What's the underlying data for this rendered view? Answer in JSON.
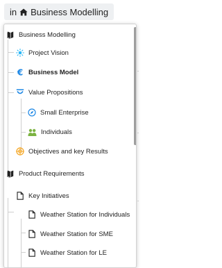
{
  "breadcrumb": {
    "prefix": "in",
    "title": "Business Modelling"
  },
  "tree": {
    "business_modelling": "Business Modelling",
    "project_vision": "Project Vision",
    "business_model": "Business Model",
    "value_propositions": "Value Propositions",
    "small_enterprise": "Small Enterprise",
    "individuals": "Individuals",
    "objectives": "Objectives and key Results",
    "product_requirements": "Product Requirements",
    "key_initiatives": "Key Initiatives",
    "ws_individuals": "Weather Station for Individuals",
    "ws_sme": "Weather Station for SME",
    "ws_le": "Weather Station for LE"
  },
  "colors": {
    "accent": "#1e88e5",
    "vision_icon": "#29b6f6",
    "objectives_icon": "#f5a623",
    "individuals_icon": "#7cb342"
  },
  "icons": {
    "home": "home-icon",
    "book": "book-icon",
    "sun": "sun-icon",
    "euro": "euro-icon",
    "value": "value-propositions-icon",
    "compass": "compass-icon",
    "users": "users-icon",
    "target": "target-icon",
    "page": "page-icon"
  }
}
